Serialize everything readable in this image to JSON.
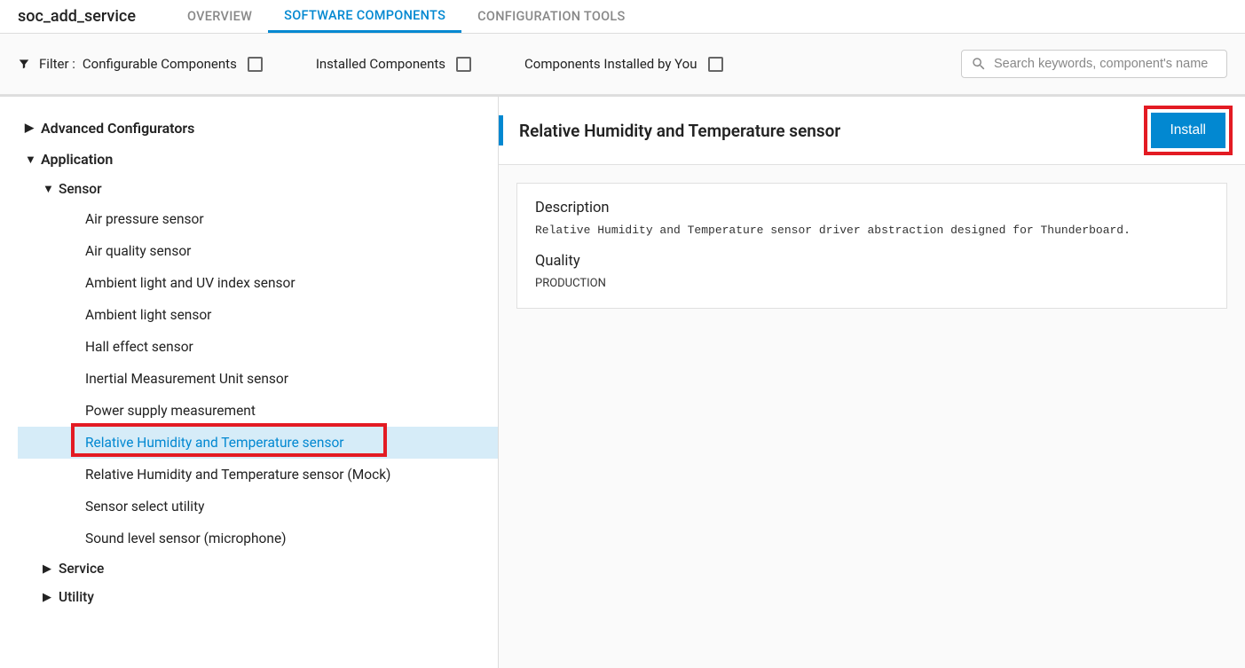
{
  "header": {
    "title": "soc_add_service",
    "tabs": [
      {
        "label": "OVERVIEW",
        "active": false
      },
      {
        "label": "SOFTWARE COMPONENTS",
        "active": true
      },
      {
        "label": "CONFIGURATION TOOLS",
        "active": false
      }
    ]
  },
  "filterbar": {
    "filter_label": "Filter :",
    "items": [
      {
        "label": "Configurable Components"
      },
      {
        "label": "Installed Components"
      },
      {
        "label": "Components Installed by You"
      }
    ],
    "search_placeholder": "Search keywords, component's name"
  },
  "tree": {
    "nodes": [
      {
        "label": "Advanced Configurators",
        "expanded": false
      },
      {
        "label": "Application",
        "expanded": true,
        "children": [
          {
            "label": "Sensor",
            "expanded": true,
            "leaves": [
              {
                "label": "Air pressure sensor"
              },
              {
                "label": "Air quality sensor"
              },
              {
                "label": "Ambient light and UV index sensor"
              },
              {
                "label": "Ambient light sensor"
              },
              {
                "label": "Hall effect sensor"
              },
              {
                "label": "Inertial Measurement Unit sensor"
              },
              {
                "label": "Power supply measurement"
              },
              {
                "label": "Relative Humidity and Temperature sensor",
                "selected": true,
                "highlighted": true
              },
              {
                "label": "Relative Humidity and Temperature sensor (Mock)"
              },
              {
                "label": "Sensor select utility"
              },
              {
                "label": "Sound level sensor (microphone)"
              }
            ]
          },
          {
            "label": "Service",
            "expanded": false
          },
          {
            "label": "Utility",
            "expanded": false
          }
        ]
      }
    ]
  },
  "detail": {
    "title": "Relative Humidity and Temperature sensor",
    "install_label": "Install",
    "description_label": "Description",
    "description_text": "Relative Humidity and Temperature sensor driver abstraction designed for Thunderboard.",
    "quality_label": "Quality",
    "quality_value": "PRODUCTION"
  }
}
